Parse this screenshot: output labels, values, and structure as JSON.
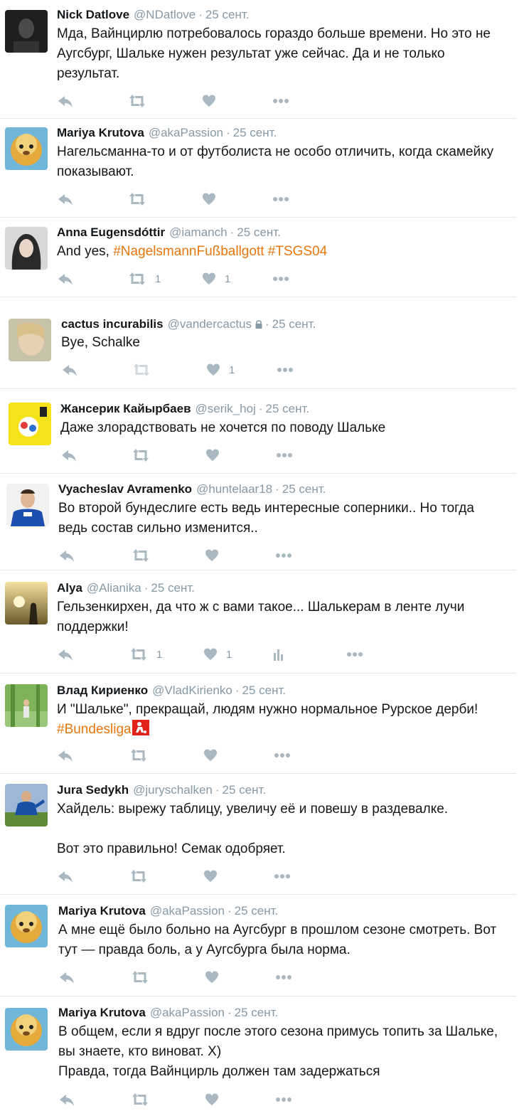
{
  "separator": "·",
  "tweets": [
    {
      "name": "Nick Datlove",
      "handle": "@NDatlove",
      "time": "25 сент.",
      "lines": [
        "Мда, Вайнцирлю потребовалось гораздо больше времени. Но это не",
        "Аугсбург, Шальке нужен результат уже сейчас. Да и не только",
        "результат."
      ],
      "retweets": "",
      "likes": ""
    },
    {
      "name": "Mariya Krutova",
      "handle": "@akaPassion",
      "time": "25 сент.",
      "lines": [
        "Нагельсманна-то и от футболиста не особо отличить, когда скамейку",
        "показывают."
      ],
      "retweets": "",
      "likes": ""
    },
    {
      "name": "Anna Eugensdóttir",
      "handle": "@iamanch",
      "time": "25 сент.",
      "text_prefix": "And yes, ",
      "hashtags": "#NagelsmannFußballgott #TSGS04",
      "retweets": "1",
      "likes": "1"
    },
    {
      "name": "cactus incurabilis",
      "handle": "@vandercactus",
      "time": "25 сент.",
      "lines": [
        "Bye, Schalke"
      ],
      "retweets": "",
      "likes": "1"
    },
    {
      "name": "Жансерик Кайырбаев",
      "handle": "@serik_hoj",
      "time": "25 сент.",
      "lines": [
        "Даже злорадствовать не хочется по поводу Шальке"
      ],
      "retweets": "",
      "likes": ""
    },
    {
      "name": "Vyacheslav Avramenko",
      "handle": "@huntelaar18",
      "time": "25 сент.",
      "lines": [
        "Во второй бундеслиге есть ведь интересные соперники..  Но тогда",
        "ведь состав сильно изменится.."
      ],
      "retweets": "",
      "likes": ""
    },
    {
      "name": "Alya",
      "handle": "@Alianika",
      "time": "25 сент.",
      "lines": [
        "Гельзенкирхен, да что ж с вами такое... Шалькерам в ленте лучи",
        "поддержки!"
      ],
      "retweets": "1",
      "likes": "1"
    },
    {
      "name": "Влад Кириенко",
      "handle": "@VladKirienko",
      "time": "25 сент.",
      "lines": [
        "И \"Шальке\", прекращай, людям нужно нормальное Рурское дерби!"
      ],
      "hashtag_line": "#Bundesliga",
      "retweets": "",
      "likes": ""
    },
    {
      "name": "Jura Sedykh",
      "handle": "@juryschalken",
      "time": "25 сент.",
      "lines": [
        "Хайдель: вырежу таблицу, увеличу её и повешу в раздевалке.",
        "Вот это правильно! Семак одобряет."
      ],
      "retweets": "",
      "likes": ""
    },
    {
      "name": "Mariya Krutova",
      "handle": "@akaPassion",
      "time": "25 сент.",
      "lines": [
        "А мне ещё было больно на Аугсбург в прошлом сезоне смотреть. Вот",
        "тут — правда боль, а у Аугсбурга была норма."
      ],
      "retweets": "",
      "likes": ""
    },
    {
      "name": "Mariya Krutova",
      "handle": "@akaPassion",
      "time": "25 сент.",
      "lines": [
        "В общем, если я вдруг после этого сезона примусь топить за Шальке,",
        "вы знаете, кто виноват. Х)",
        "Правда, тогда Вайнцирль должен там задержаться"
      ],
      "retweets": "",
      "likes": ""
    }
  ],
  "colors": {
    "text": "#14171a",
    "meta": "#8899a6",
    "icon": "#aab8c2",
    "hashtag": "#e8760e",
    "divider": "#e1e8ed"
  }
}
